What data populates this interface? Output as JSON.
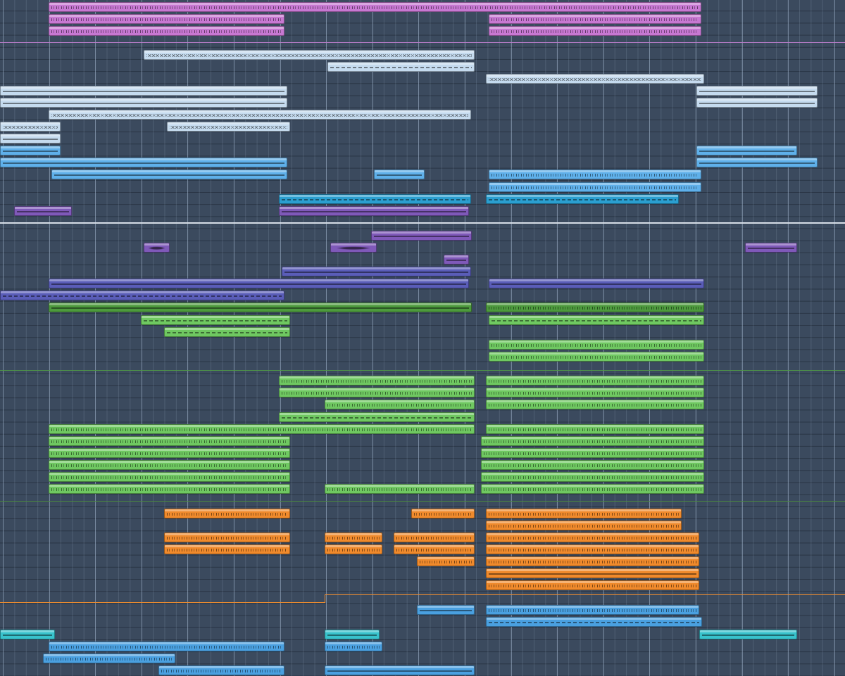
{
  "app": {
    "view": "arrange-window"
  },
  "colors": {
    "background": "#3b4a5e",
    "pink": "#c778d2",
    "ice": "#c5dbef",
    "lightblue": "#5fb0ea",
    "cyan": "#2b9fd0",
    "violet": "#7f59b9",
    "indigo": "#5a5db8",
    "darkgreen": "#4d9a3d",
    "green": "#6fc861",
    "orange": "#f08a2c",
    "teal": "#38c2cc",
    "skyblue": "#4aa0e0"
  }
}
